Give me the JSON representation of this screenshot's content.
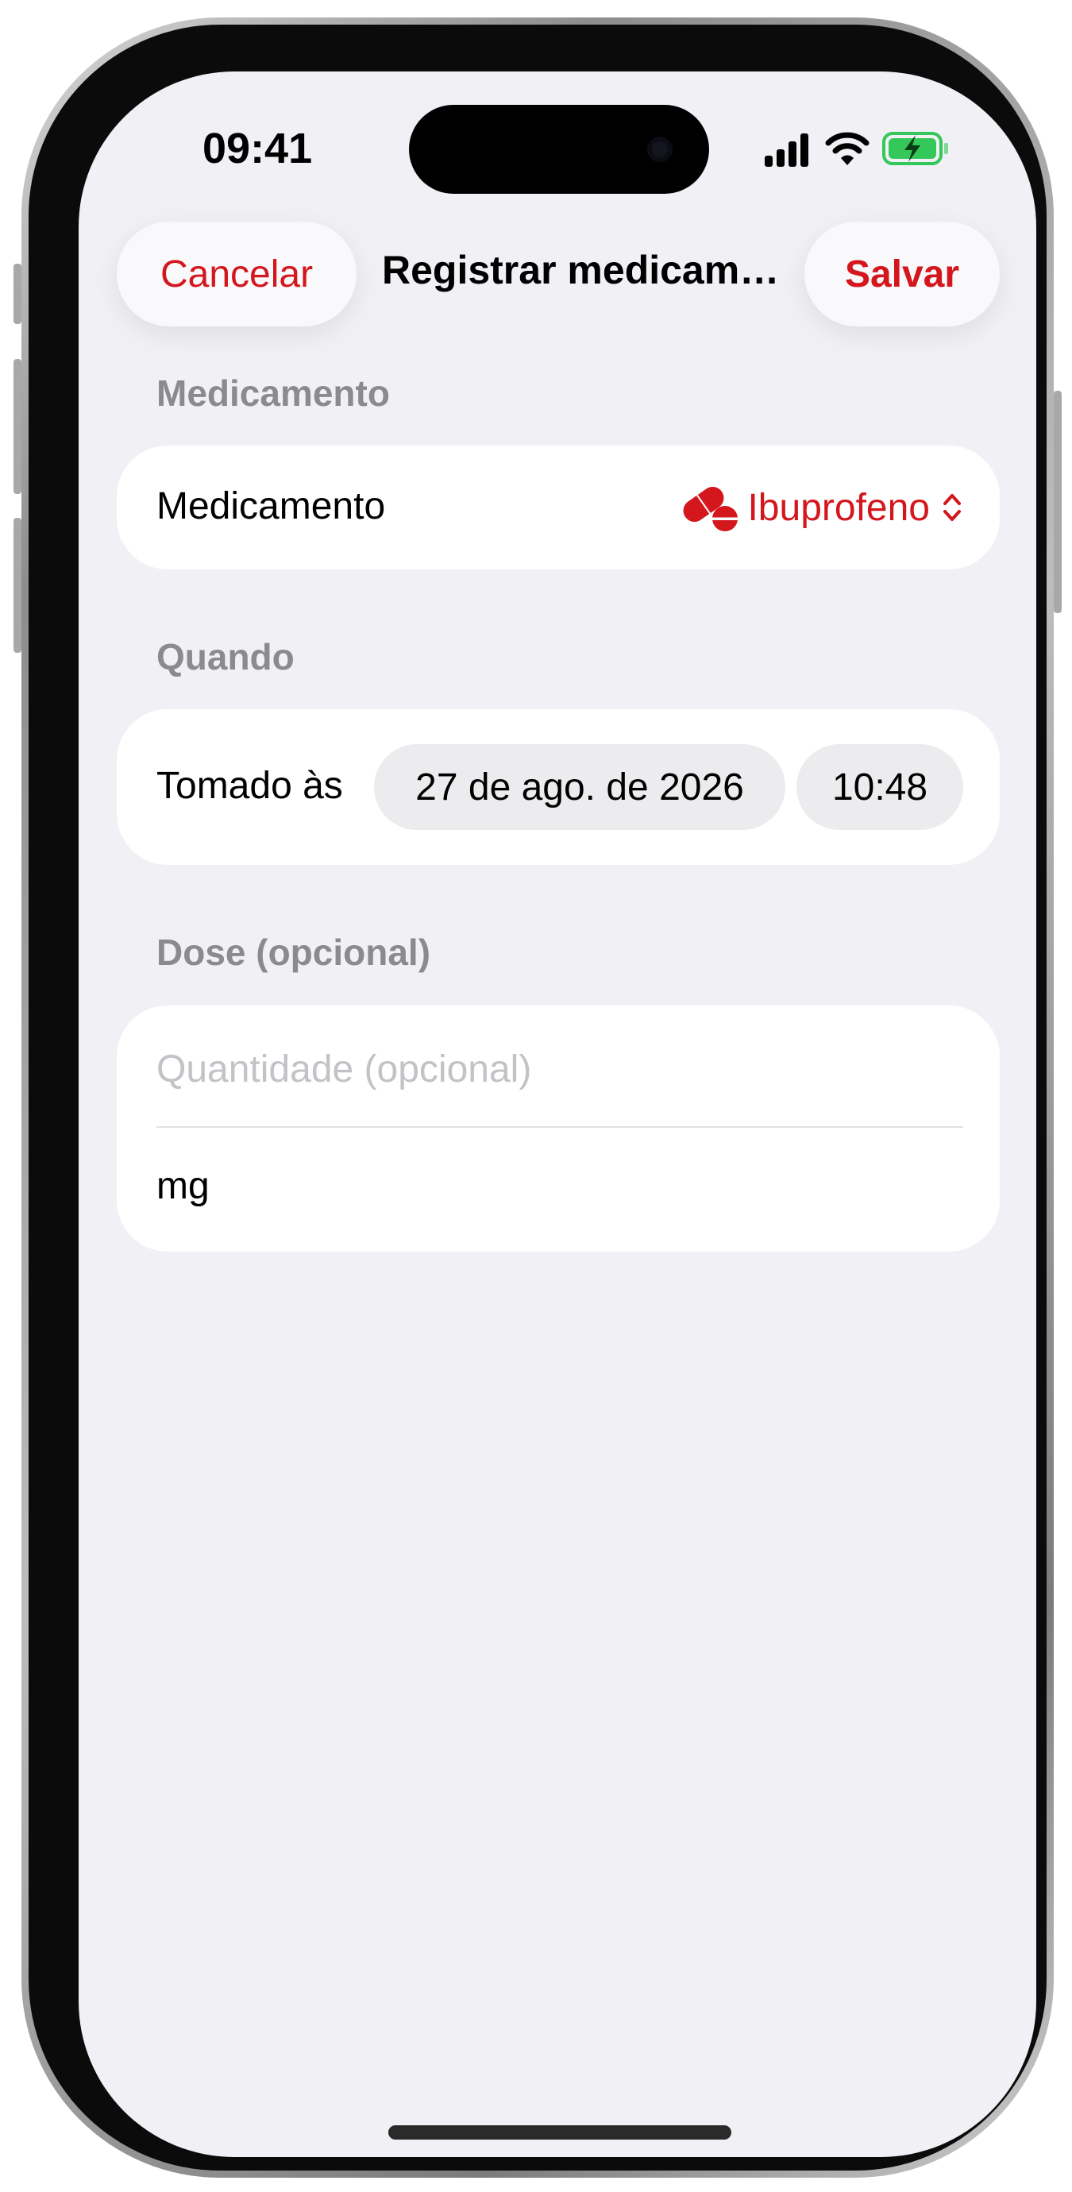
{
  "status_bar": {
    "time": "09:41",
    "icons": [
      "cellular-signal-icon",
      "wifi-icon",
      "battery-charging-icon"
    ]
  },
  "nav": {
    "cancel_label": "Cancelar",
    "title": "Registrar medicam…",
    "save_label": "Salvar"
  },
  "sections": {
    "medication": {
      "header": "Medicamento",
      "row_label": "Medicamento",
      "selected_value": "Ibuprofeno",
      "icon": "pill-icon",
      "chevron_icon": "chevron-up-down-icon"
    },
    "when": {
      "header": "Quando",
      "row_label": "Tomado às",
      "date_value": "27 de ago. de 2026",
      "time_value": "10:48"
    },
    "dose": {
      "header": "Dose (opcional)",
      "quantity_placeholder": "Quantidade (opcional)",
      "quantity_value": "",
      "unit_value": "mg"
    }
  },
  "colors": {
    "accent": "#d4161d",
    "background": "#f0f0f5",
    "card": "#ffffff",
    "section_header": "#8a8a8f",
    "placeholder": "#c2c2c7",
    "chip": "#ececef",
    "battery_fill": "#34c759"
  }
}
